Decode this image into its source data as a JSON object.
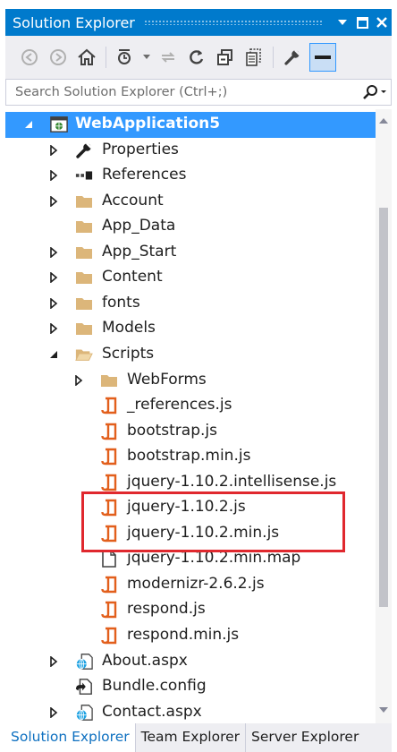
{
  "window": {
    "title": "Solution Explorer",
    "pin_glyph": "▼",
    "maximize_glyph": "□",
    "close_glyph": "✕"
  },
  "toolbar": {
    "icons": [
      "back-icon",
      "forward-icon",
      "home-icon",
      "pending-changes-filter-icon",
      "sync-icon",
      "refresh-icon",
      "collapse-all-icon",
      "show-all-files-icon",
      "properties-wrench-icon",
      "preview-selected-icon"
    ]
  },
  "search": {
    "placeholder": "Search Solution Explorer (Ctrl+;)"
  },
  "tree": {
    "items": [
      {
        "label": "WebApplication5",
        "expander": "expanded",
        "icon": "web-project-icon",
        "selected": true
      },
      {
        "label": "Properties",
        "expander": "collapsed",
        "icon": "wrench-icon"
      },
      {
        "label": "References",
        "expander": "collapsed",
        "icon": "references-icon"
      },
      {
        "label": "Account",
        "expander": "collapsed",
        "icon": "folder-icon"
      },
      {
        "label": "App_Data",
        "expander": "none",
        "icon": "folder-icon"
      },
      {
        "label": "App_Start",
        "expander": "collapsed",
        "icon": "folder-icon"
      },
      {
        "label": "Content",
        "expander": "collapsed",
        "icon": "folder-icon"
      },
      {
        "label": "fonts",
        "expander": "collapsed",
        "icon": "folder-icon"
      },
      {
        "label": "Models",
        "expander": "collapsed",
        "icon": "folder-icon"
      },
      {
        "label": "Scripts",
        "expander": "expanded",
        "icon": "folder-open-icon"
      },
      {
        "label": "WebForms",
        "expander": "collapsed",
        "icon": "folder-icon"
      },
      {
        "label": "_references.js",
        "expander": "none",
        "icon": "js-file-icon"
      },
      {
        "label": "bootstrap.js",
        "expander": "none",
        "icon": "js-file-icon"
      },
      {
        "label": "bootstrap.min.js",
        "expander": "none",
        "icon": "js-file-icon"
      },
      {
        "label": "jquery-1.10.2.intellisense.js",
        "expander": "none",
        "icon": "js-file-icon"
      },
      {
        "label": "jquery-1.10.2.js",
        "expander": "none",
        "icon": "js-file-icon"
      },
      {
        "label": "jquery-1.10.2.min.js",
        "expander": "none",
        "icon": "js-file-icon"
      },
      {
        "label": "jquery-1.10.2.min.map",
        "expander": "none",
        "icon": "file-icon"
      },
      {
        "label": "modernizr-2.6.2.js",
        "expander": "none",
        "icon": "js-file-icon"
      },
      {
        "label": "respond.js",
        "expander": "none",
        "icon": "js-file-icon"
      },
      {
        "label": "respond.min.js",
        "expander": "none",
        "icon": "js-file-icon"
      },
      {
        "label": "About.aspx",
        "expander": "collapsed",
        "icon": "aspx-file-icon"
      },
      {
        "label": "Bundle.config",
        "expander": "none",
        "icon": "config-file-icon"
      },
      {
        "label": "Contact.aspx",
        "expander": "collapsed",
        "icon": "aspx-file-icon"
      }
    ]
  },
  "tabs": [
    {
      "label": "Solution Explorer",
      "active": true
    },
    {
      "label": "Team Explorer",
      "active": false
    },
    {
      "label": "Server Explorer",
      "active": false
    }
  ],
  "colors": {
    "accent": "#007acc",
    "selection": "#3399ff",
    "highlight_box": "#e0282e",
    "folder": "#dcb67a",
    "js_icon": "#e25f1c"
  }
}
